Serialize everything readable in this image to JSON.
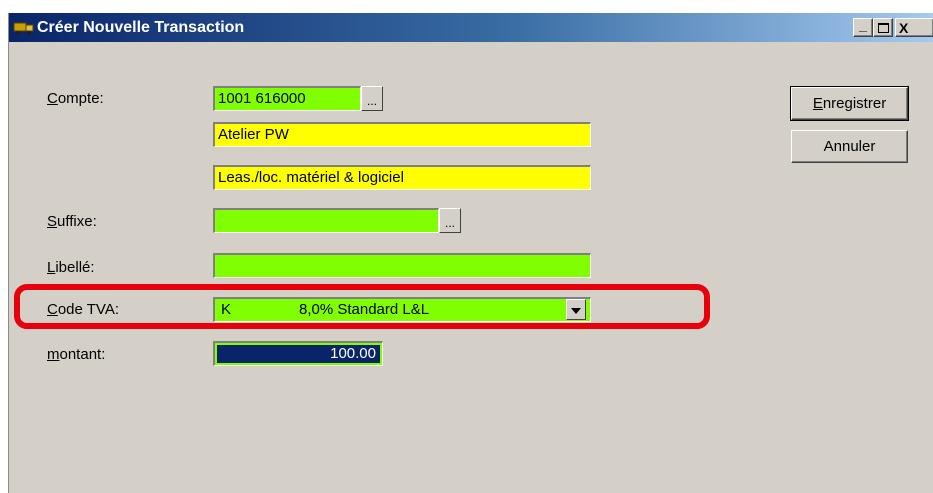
{
  "window": {
    "title": "Créer Nouvelle Transaction",
    "controls": {
      "minimize": "_",
      "close": "X"
    }
  },
  "form": {
    "compte": {
      "label": "Compte:",
      "value": "1001 616000",
      "dots": "...",
      "name_line": "Atelier PW",
      "description_line": "Leas./loc. matériel & logiciel"
    },
    "suffixe": {
      "label": "Suffixe:",
      "value": "",
      "dots": "..."
    },
    "libelle": {
      "label": "Libellé:",
      "value": ""
    },
    "code_tva": {
      "label": "Code TVA:",
      "code": "K",
      "description": "8,0% Standard L&L"
    },
    "montant": {
      "label": "montant:",
      "value": "100.00"
    }
  },
  "buttons": {
    "save": "Enregistrer",
    "cancel": "Annuler"
  },
  "colors": {
    "field_green": "#80ff00",
    "field_yellow": "#ffff00",
    "highlight_red": "#e8000b",
    "selection_blue": "#0a246a"
  }
}
